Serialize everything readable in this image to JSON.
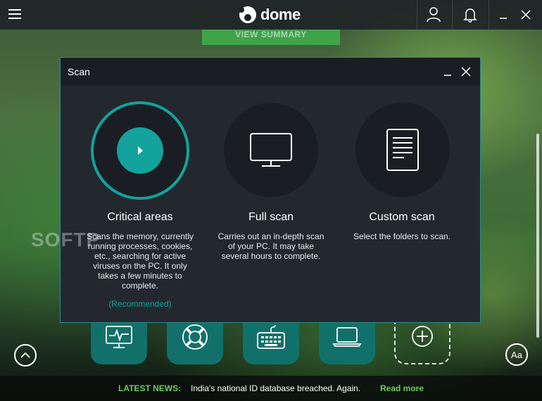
{
  "app": {
    "logo_text": "dome",
    "logo_brand": "panda"
  },
  "background": {
    "view_summary_label": "VIEW SUMMARY",
    "watermark": "SOFTP"
  },
  "dialog": {
    "title": "Scan",
    "options": [
      {
        "title": "Critical areas",
        "desc_lines": [
          "Scans the memory, currently",
          "running processes, cookies,",
          "etc., searching for active",
          "viruses on the PC. It only",
          "takes a few minutes to",
          "complete."
        ],
        "recommended": "(Recommended)"
      },
      {
        "title": "Full scan",
        "desc_lines": [
          "Carries out an in-depth scan",
          "of your PC. It may take",
          "several hours to complete."
        ]
      },
      {
        "title": "Custom scan",
        "desc_lines": [
          "Select the folders to scan."
        ]
      }
    ]
  },
  "bottom": {
    "font_button": "Aa"
  },
  "news": {
    "label": "LATEST NEWS:",
    "headline": "India's national ID database breached. Again.",
    "link": "Read more"
  },
  "colors": {
    "accent": "#13a39c",
    "news_green": "#6dcf5a",
    "tile": "#11706a"
  }
}
